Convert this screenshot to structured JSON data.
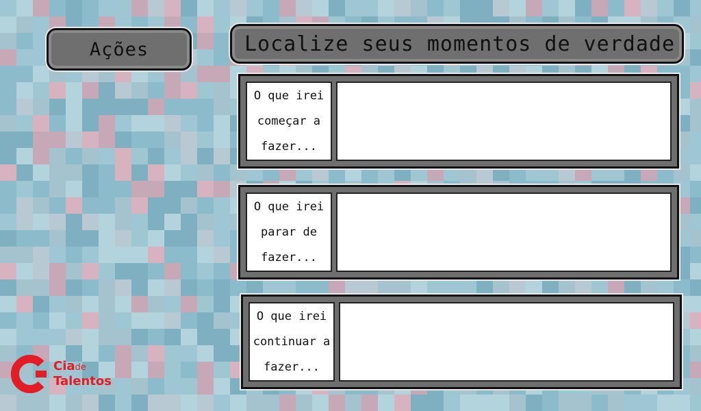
{
  "sidebar": {
    "title": "Ações"
  },
  "header": {
    "title": "Localize seus momentos de verdade"
  },
  "rows": [
    {
      "label": "O que irei\ncomeçar a\nfazer...",
      "value": ""
    },
    {
      "label": "O que irei\nparar de\nfazer...",
      "value": ""
    },
    {
      "label": "O que irei\ncontinuar a\nfazer...",
      "value": ""
    }
  ],
  "logo": {
    "brand_top": "Cia",
    "brand_mid": "de",
    "brand_bottom": "Talentos",
    "color": "#e11d26"
  },
  "theme": {
    "panel_fill": "#6f6f6f",
    "outline": "#111111",
    "background_palette": [
      "#9fc7d3",
      "#8cbccb",
      "#b3d4dd",
      "#a5c2cf",
      "#c7a8b6",
      "#d7b3c0",
      "#7eb0c1",
      "#b9c9d4"
    ]
  }
}
